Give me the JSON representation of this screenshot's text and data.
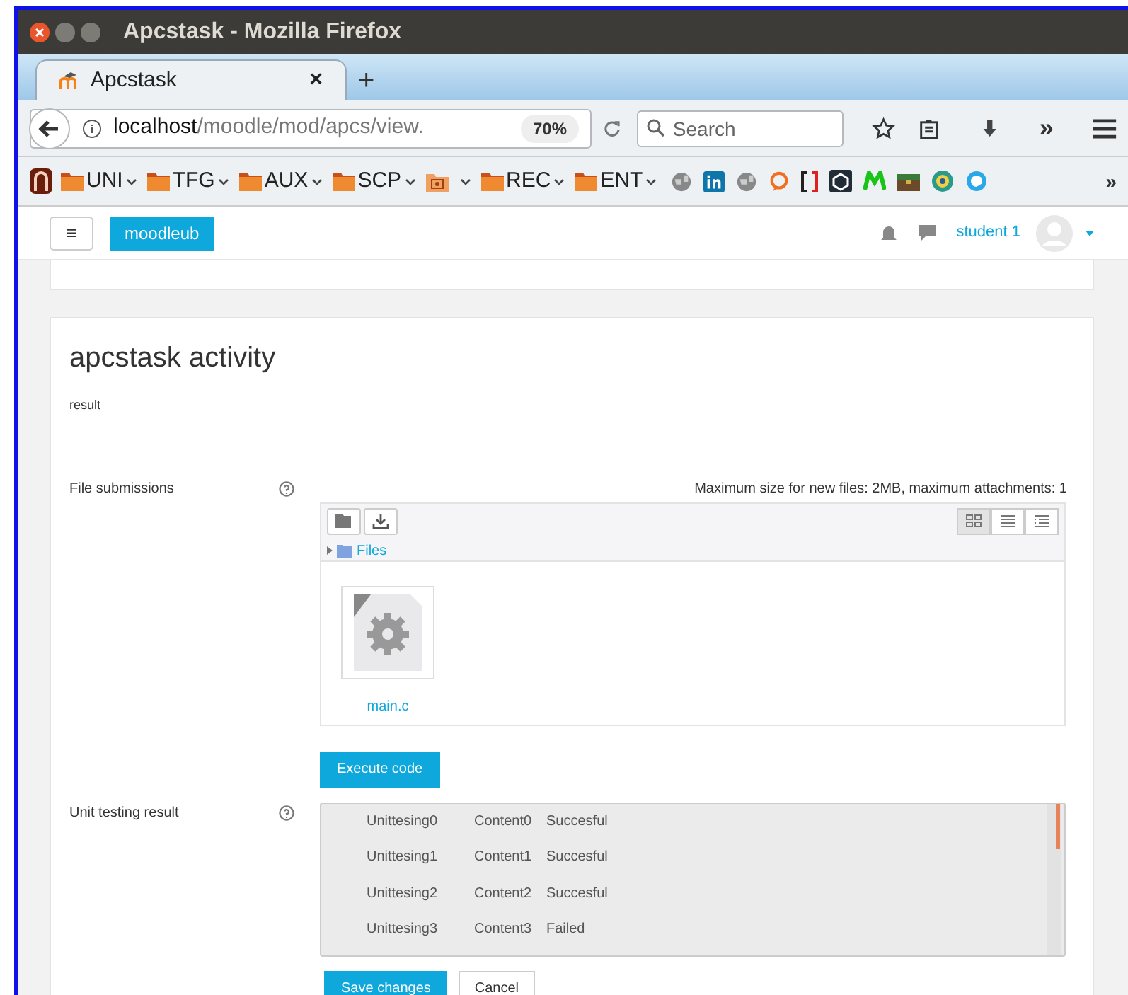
{
  "window": {
    "title": "Apcstask - Mozilla Firefox"
  },
  "tabs": [
    {
      "label": "Apcstask",
      "selected": true,
      "close": "×"
    }
  ],
  "new_tab": "+",
  "address_bar": {
    "host": "localhost",
    "path": "/moodle/mod/apcs/view.",
    "zoom": "70%"
  },
  "search": {
    "placeholder": "Search"
  },
  "toolbar_overflow": "»",
  "bookmarks": [
    {
      "kind": "folder",
      "label": "UNI"
    },
    {
      "kind": "folder",
      "label": "TFG"
    },
    {
      "kind": "folder",
      "label": "AUX"
    },
    {
      "kind": "folder",
      "label": "SCP"
    },
    {
      "kind": "image_folder"
    },
    {
      "kind": "folder",
      "label": "REC"
    },
    {
      "kind": "folder",
      "label": "ENT"
    }
  ],
  "bookmarks_overflow": "»",
  "navbar": {
    "site": "moodleub",
    "menu": "≡",
    "user": "student 1"
  },
  "page": {
    "title": "apcstask activity",
    "description": "result"
  },
  "file_submissions": {
    "label": "File submissions",
    "limits": "Maximum size for new files: 2MB, maximum attachments: 1",
    "path": "Files",
    "views": [
      {
        "kind": "icons",
        "selected": true
      },
      {
        "kind": "list",
        "selected": false
      },
      {
        "kind": "tree",
        "selected": false
      }
    ],
    "files": [
      {
        "name": "main.c"
      }
    ]
  },
  "execute_button": "Execute code",
  "unit_testing": {
    "label": "Unit testing result",
    "rows": [
      {
        "name": "Unittesing0",
        "content": "Content0",
        "result": "Succesful"
      },
      {
        "name": "Unittesing1",
        "content": "Content1",
        "result": "Succesful"
      },
      {
        "name": "Unittesing2",
        "content": "Content2",
        "result": "Succesful"
      },
      {
        "name": "Unittesing3",
        "content": "Content3",
        "result": "Failed"
      }
    ]
  },
  "buttons": [
    {
      "kind": "primary",
      "label": "Save changes"
    },
    {
      "kind": "secondary",
      "label": "Cancel"
    }
  ]
}
